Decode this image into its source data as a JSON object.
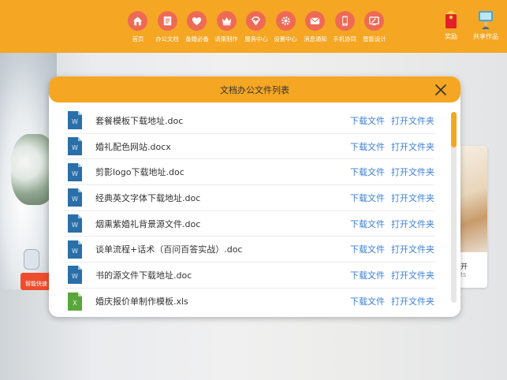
{
  "nav": {
    "items": [
      {
        "label": "首页",
        "icon": "home-icon"
      },
      {
        "label": "办公文档",
        "icon": "document-icon"
      },
      {
        "label": "备婚必备",
        "icon": "heart-icon"
      },
      {
        "label": "请柬制作",
        "icon": "crown-icon"
      },
      {
        "label": "服务中心",
        "icon": "diamond-icon"
      },
      {
        "label": "设置中心",
        "icon": "gear-icon"
      },
      {
        "label": "消息通知",
        "icon": "mail-icon"
      },
      {
        "label": "手机协同",
        "icon": "phone-icon"
      },
      {
        "label": "智能设计",
        "icon": "design-icon"
      }
    ],
    "reward_label": "奖励",
    "share_label": "共享作品"
  },
  "background": {
    "robot_tag": "智能快速",
    "side_card_title": "开",
    "side_card_sub": "ts"
  },
  "modal": {
    "title": "文档办公文件列表",
    "files": [
      {
        "name": "套餐模板下载地址.doc",
        "type": "word",
        "download": "下载文件",
        "open": "打开文件夹"
      },
      {
        "name": "婚礼配色网站.docx",
        "type": "word",
        "download": "下载文件",
        "open": "打开文件夹"
      },
      {
        "name": "剪影logo下载地址.doc",
        "type": "word",
        "download": "下载文件",
        "open": "打开文件夹"
      },
      {
        "name": "经典英文字体下载地址.doc",
        "type": "word",
        "download": "下载文件",
        "open": "打开文件夹"
      },
      {
        "name": "烟熏紫婚礼背景源文件.doc",
        "type": "word",
        "download": "下载文件",
        "open": "打开文件夹"
      },
      {
        "name": "谈单流程+话术（百问百答实战）.doc",
        "type": "word",
        "download": "下载文件",
        "open": "打开文件夹"
      },
      {
        "name": "书的源文件下载地址.doc",
        "type": "word",
        "download": "下载文件",
        "open": "打开文件夹"
      },
      {
        "name": "婚庆报价单制作模板.xls",
        "type": "excel",
        "download": "下载文件",
        "open": "打开文件夹"
      }
    ]
  },
  "colors": {
    "accent": "#f5a623",
    "nav_circle": "#ee6a55",
    "link": "#3b7fd9",
    "word_icon": "#2a6fa8",
    "excel_icon": "#5aa53c"
  }
}
